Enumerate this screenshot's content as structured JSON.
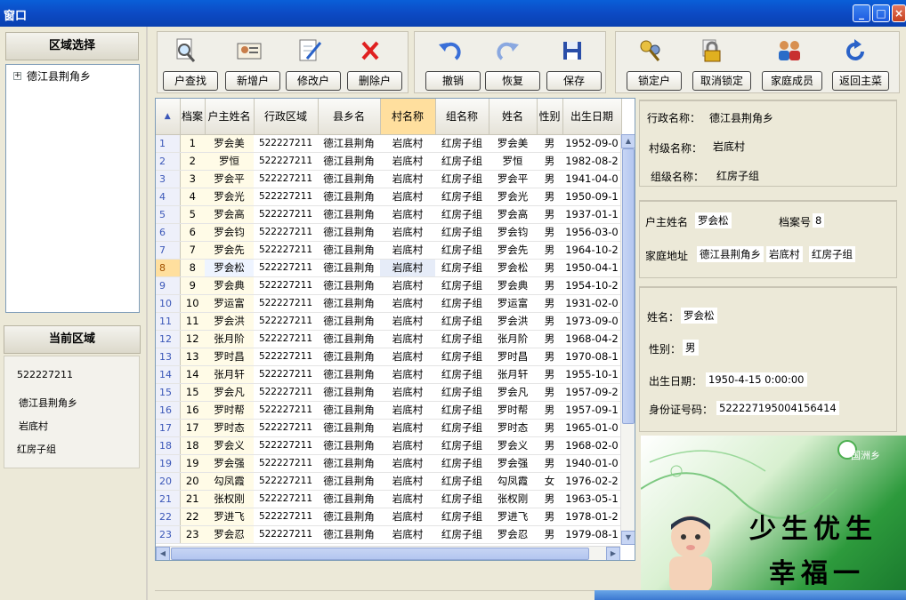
{
  "window": {
    "title": "窗口"
  },
  "left": {
    "region_select_title": "区域选择",
    "tree_root": "德江县荆角乡",
    "current_area_title": "当前区域",
    "current_area": {
      "code": "522227211",
      "township": "德江县荆角乡",
      "village": "岩底村",
      "group": "红房子组"
    }
  },
  "toolbar": {
    "group1": [
      {
        "label": "户查找",
        "icon": "magnifier-icon"
      },
      {
        "label": "新增户",
        "icon": "id-card-icon"
      },
      {
        "label": "修改户",
        "icon": "edit-document-icon"
      },
      {
        "label": "删除户",
        "icon": "delete-x-icon"
      }
    ],
    "group2": [
      {
        "label": "撤销",
        "icon": "undo-icon"
      },
      {
        "label": "恢复",
        "icon": "redo-icon"
      },
      {
        "label": "保存",
        "icon": "floppy-disk-icon"
      }
    ],
    "group3": [
      {
        "label": "锁定户",
        "icon": "keys-icon"
      },
      {
        "label": "取消锁定",
        "icon": "padlock-icon"
      },
      {
        "label": "家庭成员",
        "icon": "family-icon"
      },
      {
        "label": "返回主菜",
        "icon": "return-icon"
      }
    ]
  },
  "grid": {
    "columns": [
      "档案",
      "户主姓名",
      "行政区域",
      "县乡名",
      "村名称",
      "组名称",
      "姓名",
      "性别",
      "出生日期"
    ],
    "rows": [
      [
        "1",
        "1",
        "罗会美",
        "522227211",
        "德江县荆角",
        "岩底村",
        "红房子组",
        "罗会美",
        "男",
        "1952-09-0"
      ],
      [
        "2",
        "2",
        "罗恒",
        "522227211",
        "德江县荆角",
        "岩底村",
        "红房子组",
        "罗恒",
        "男",
        "1982-08-2"
      ],
      [
        "3",
        "3",
        "罗会平",
        "522227211",
        "德江县荆角",
        "岩底村",
        "红房子组",
        "罗会平",
        "男",
        "1941-04-0"
      ],
      [
        "4",
        "4",
        "罗会光",
        "522227211",
        "德江县荆角",
        "岩底村",
        "红房子组",
        "罗会光",
        "男",
        "1950-09-1"
      ],
      [
        "5",
        "5",
        "罗会高",
        "522227211",
        "德江县荆角",
        "岩底村",
        "红房子组",
        "罗会高",
        "男",
        "1937-01-1"
      ],
      [
        "6",
        "6",
        "罗会钧",
        "522227211",
        "德江县荆角",
        "岩底村",
        "红房子组",
        "罗会钧",
        "男",
        "1956-03-0"
      ],
      [
        "7",
        "7",
        "罗会先",
        "522227211",
        "德江县荆角",
        "岩底村",
        "红房子组",
        "罗会先",
        "男",
        "1964-10-2"
      ],
      [
        "8",
        "8",
        "罗会松",
        "522227211",
        "德江县荆角",
        "岩底村",
        "红房子组",
        "罗会松",
        "男",
        "1950-04-1"
      ],
      [
        "9",
        "9",
        "罗会典",
        "522227211",
        "德江县荆角",
        "岩底村",
        "红房子组",
        "罗会典",
        "男",
        "1954-10-2"
      ],
      [
        "10",
        "10",
        "罗运富",
        "522227211",
        "德江县荆角",
        "岩底村",
        "红房子组",
        "罗运富",
        "男",
        "1931-02-0"
      ],
      [
        "11",
        "11",
        "罗会洪",
        "522227211",
        "德江县荆角",
        "岩底村",
        "红房子组",
        "罗会洪",
        "男",
        "1973-09-0"
      ],
      [
        "12",
        "12",
        "张月阶",
        "522227211",
        "德江县荆角",
        "岩底村",
        "红房子组",
        "张月阶",
        "男",
        "1968-04-2"
      ],
      [
        "13",
        "13",
        "罗时昌",
        "522227211",
        "德江县荆角",
        "岩底村",
        "红房子组",
        "罗时昌",
        "男",
        "1970-08-1"
      ],
      [
        "14",
        "14",
        "张月轩",
        "522227211",
        "德江县荆角",
        "岩底村",
        "红房子组",
        "张月轩",
        "男",
        "1955-10-1"
      ],
      [
        "15",
        "15",
        "罗会凡",
        "522227211",
        "德江县荆角",
        "岩底村",
        "红房子组",
        "罗会凡",
        "男",
        "1957-09-2"
      ],
      [
        "16",
        "16",
        "罗时帮",
        "522227211",
        "德江县荆角",
        "岩底村",
        "红房子组",
        "罗时帮",
        "男",
        "1957-09-1"
      ],
      [
        "17",
        "17",
        "罗时态",
        "522227211",
        "德江县荆角",
        "岩底村",
        "红房子组",
        "罗时态",
        "男",
        "1965-01-0"
      ],
      [
        "18",
        "18",
        "罗会义",
        "522227211",
        "德江县荆角",
        "岩底村",
        "红房子组",
        "罗会义",
        "男",
        "1968-02-0"
      ],
      [
        "19",
        "19",
        "罗会强",
        "522227211",
        "德江县荆角",
        "岩底村",
        "红房子组",
        "罗会强",
        "男",
        "1940-01-0"
      ],
      [
        "20",
        "20",
        "勾凤霞",
        "522227211",
        "德江县荆角",
        "岩底村",
        "红房子组",
        "勾凤霞",
        "女",
        "1976-02-2"
      ],
      [
        "21",
        "21",
        "张权刚",
        "522227211",
        "德江县荆角",
        "岩底村",
        "红房子组",
        "张权刚",
        "男",
        "1963-05-1"
      ],
      [
        "22",
        "22",
        "罗进飞",
        "522227211",
        "德江县荆角",
        "岩底村",
        "红房子组",
        "罗进飞",
        "男",
        "1978-01-2"
      ],
      [
        "23",
        "23",
        "罗会忍",
        "522227211",
        "德江县荆角",
        "岩底村",
        "红房子组",
        "罗会忍",
        "男",
        "1979-08-1"
      ]
    ]
  },
  "info_admin": {
    "admin_label": "行政名称：",
    "admin_value": "德江县荆角乡",
    "village_label": "村级名称：",
    "village_value": "岩底村",
    "group_label": "组级名称：",
    "group_value": "红房子组"
  },
  "info_household": {
    "head_label": "户主姓名",
    "head_value": "罗会松",
    "file_label": "档案号",
    "file_value": "8",
    "address_label": "家庭地址",
    "address_township": "德江县荆角乡",
    "address_village": "岩底村",
    "address_group": "红房子组"
  },
  "info_person": {
    "name_label": "姓名：",
    "name_value": "罗会松",
    "gender_label": "性别：",
    "gender_value": "男",
    "birth_label": "出生日期：",
    "birth_value": "1950-4-15 0:00:00",
    "id_label": "身份证号码：",
    "id_value": "522227195004156414"
  },
  "ad": {
    "slogan_line1": "少生优生",
    "slogan_line2": "幸福一",
    "brand": "国洲乡"
  }
}
